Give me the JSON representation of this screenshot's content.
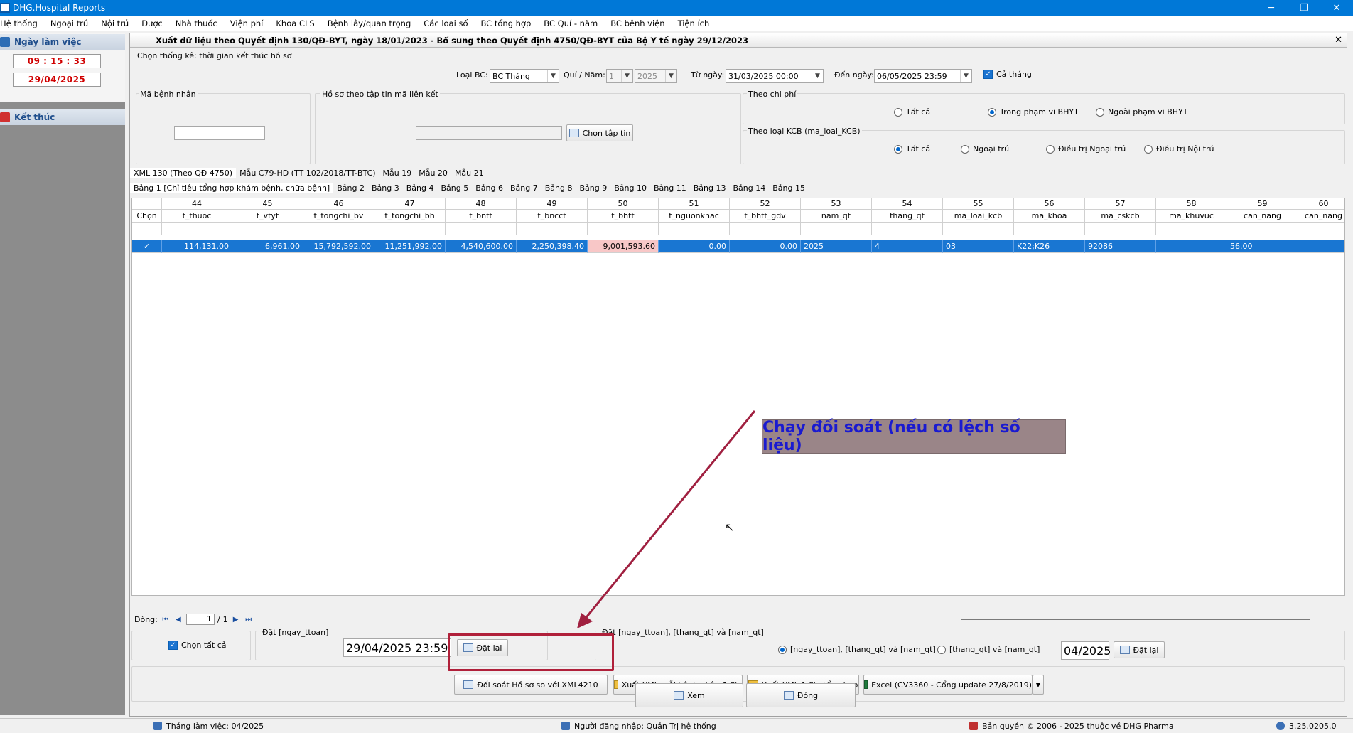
{
  "window": {
    "title": "DHG.Hospital Reports",
    "min": "─",
    "max": "❐",
    "close": "✕"
  },
  "menu": [
    "Hệ thống",
    "Ngoại trú",
    "Nội trú",
    "Dược",
    "Nhà thuốc",
    "Viện phí",
    "Khoa CLS",
    "Bệnh lây/quan trọng",
    "Các loại số",
    "BC tổng hợp",
    "BC Quí - năm",
    "BC bệnh viện",
    "Tiện ích"
  ],
  "sidebar": {
    "work_day_label": "Ngày làm việc",
    "time": "09 : 15 : 33",
    "date": "29/04/2025",
    "exit_label": "Kết thúc"
  },
  "form": {
    "title": "Xuất dữ liệu theo Quyết định 130/QĐ-BYT, ngày 18/01/2023 - Bổ sung theo Quyết định 4750/QĐ-BYT của Bộ Y tế ngày 29/12/2023",
    "close": "✕",
    "stat_group_label": "Chọn thống kê: thời gian kết thúc hồ sơ",
    "loai_bc_label": "Loại BC:",
    "loai_bc_value": "BC Tháng",
    "qui_nam_label": "Quí / Năm:",
    "qui_value": "1",
    "nam_value": "2025",
    "tu_ngay_label": "Từ ngày:",
    "tu_ngay_value": "31/03/2025 00:00",
    "den_ngay_label": "Đến ngày:",
    "den_ngay_value": "06/05/2025 23:59",
    "ca_thang_label": "Cả tháng",
    "ma_benh_nhan_label": "Mã bệnh nhân",
    "ma_benh_nhan_value": "",
    "ho_so_label": "Hồ sơ theo tập tin mã liên kết",
    "ho_so_value": "",
    "chon_tap_tin": "Chọn tập tin",
    "theo_chi_phi_label": "Theo chi phí",
    "chi_phi_options": [
      "Tất cả",
      "Trong phạm vi BHYT",
      "Ngoài phạm vi BHYT"
    ],
    "theo_loai_kcb_label": "Theo loại KCB (ma_loai_KCB)",
    "kcb_options": [
      "Tất cả",
      "Ngoại trú",
      "Điều trị Ngoại trú",
      "Điều trị Nội trú"
    ]
  },
  "tabs_top": [
    "XML 130 (Theo QĐ 4750)",
    "Mẫu C79-HD (TT 102/2018/TT-BTC)",
    "Mẫu 19",
    "Mẫu 20",
    "Mẫu 21"
  ],
  "tabs_bang": [
    "Bảng 1 [Chỉ tiêu tổng hợp khám bệnh, chữa bệnh]",
    "Bảng 2",
    "Bảng 3",
    "Bảng 4",
    "Bảng 5",
    "Bảng 6",
    "Bảng 7",
    "Bảng 8",
    "Bảng 9",
    "Bảng 10",
    "Bảng 11",
    "Bảng 13",
    "Bảng 14",
    "Bảng 15"
  ],
  "grid": {
    "chon_label": "Chọn",
    "check_mark": "✓",
    "col_numbers": [
      "44",
      "45",
      "46",
      "47",
      "48",
      "49",
      "50",
      "51",
      "52",
      "53",
      "54",
      "55",
      "56",
      "57",
      "58",
      "59",
      "60"
    ],
    "col_names": [
      "t_thuoc",
      "t_vtyt",
      "t_tongchi_bv",
      "t_tongchi_bh",
      "t_bntt",
      "t_bncct",
      "t_bhtt",
      "t_nguonkhac",
      "t_bhtt_gdv",
      "nam_qt",
      "thang_qt",
      "ma_loai_kcb",
      "ma_khoa",
      "ma_cskcb",
      "ma_khuvuc",
      "can_nang",
      "can_nang"
    ],
    "row": [
      "114,131.00",
      "6,961.00",
      "15,792,592.00",
      "11,251,992.00",
      "4,540,600.00",
      "2,250,398.40",
      "9,001,593.60",
      "0.00",
      "0.00",
      "2025",
      "4",
      "03",
      "K22;K26",
      "92086",
      "",
      "56.00",
      ""
    ],
    "totals": [
      "114,131.00",
      "6,961.00",
      "15,792,592.00",
      "11,251,992.00",
      "4,540,600.00",
      "2,250,398.40",
      "9,001,593.60",
      "0.00",
      "0.00",
      "",
      "",
      "",
      "",
      "",
      "",
      "",
      ""
    ]
  },
  "pager": {
    "label": "Dòng:",
    "current": "1",
    "sep": "/",
    "total": "1"
  },
  "bottom": {
    "chon_tat_ca": "Chọn tất cả",
    "dat_ngay_ttoan_label": "Đặt [ngay_ttoan]",
    "dat_ngay_ttoan_value": "29/04/2025 23:59",
    "dat_lai": "Đặt lại",
    "dat_group_label": "Đặt  [ngay_ttoan], [thang_qt] và [nam_qt]",
    "radio_1": "[ngay_ttoan], [thang_qt] và [nam_qt]",
    "radio_2": "[thang_qt] và [nam_qt]",
    "month_value": "04/2025",
    "btn_doi_soat": "Đối soát Hồ sơ so với XML4210",
    "btn_xuat_moi": "Xuất XML mỗi bệnh nhân 1 file",
    "btn_xuat_tong": "Xuất XML 1 file tổng hợp",
    "btn_excel": "Excel (CV3360 - Cổng update 27/8/2019)",
    "btn_xem": "Xem",
    "btn_dong": "Đóng"
  },
  "annotation": {
    "callout": "Chạy đối soát (nếu có lệch số liệu)"
  },
  "status": {
    "thang_lam_viec": "Tháng làm việc: 04/2025",
    "nguoi_dang_nhap": "Người đăng nhập: Quản Trị hệ thống",
    "ban_quyen": "Bản quyền © 2006 - 2025 thuộc về DHG Pharma",
    "version": "3.25.0205.0"
  },
  "colors": {
    "accent": "#0078d7",
    "selection": "#1976d2",
    "highlight": "#f8c7c7",
    "annotation_red": "#b0203a"
  }
}
